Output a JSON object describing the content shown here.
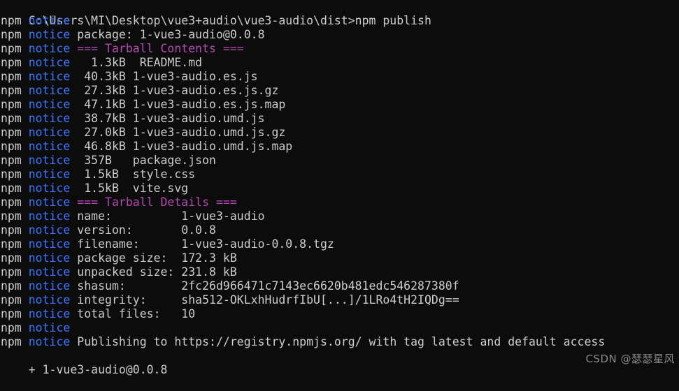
{
  "terminal": {
    "background_color": "#0c0c0c",
    "default_text_color": "#cccccc",
    "notice_color": "#3b78ff",
    "heading_color": "#b44ab4",
    "prompt_line": "C:\\Users\\MI\\Desktop\\vue3+audio\\vue3-audio\\dist>npm publish",
    "prompt_path": "C:\\Users\\MI\\Desktop\\vue3+audio\\vue3-audio\\dist>",
    "command": "npm publish",
    "prefix_npm": "npm ",
    "prefix_notice": "notice",
    "lines": [
      {
        "prefix": "npm ",
        "tag": "notice",
        "rest": "",
        "rest_color": "default"
      },
      {
        "prefix": "npm ",
        "tag": "notice",
        "rest": " package: 1-vue3-audio@0.0.8",
        "rest_color": "default"
      },
      {
        "prefix": "npm ",
        "tag": "notice",
        "rest": " === Tarball Contents ===",
        "rest_color": "magenta"
      },
      {
        "prefix": "npm ",
        "tag": "notice",
        "rest": "   1.3kB  README.md",
        "rest_color": "default"
      },
      {
        "prefix": "npm ",
        "tag": "notice",
        "rest": "  40.3kB 1-vue3-audio.es.js",
        "rest_color": "default"
      },
      {
        "prefix": "npm ",
        "tag": "notice",
        "rest": "  27.3kB 1-vue3-audio.es.js.gz",
        "rest_color": "default"
      },
      {
        "prefix": "npm ",
        "tag": "notice",
        "rest": "  47.1kB 1-vue3-audio.es.js.map",
        "rest_color": "default"
      },
      {
        "prefix": "npm ",
        "tag": "notice",
        "rest": "  38.7kB 1-vue3-audio.umd.js",
        "rest_color": "default"
      },
      {
        "prefix": "npm ",
        "tag": "notice",
        "rest": "  27.0kB 1-vue3-audio.umd.js.gz",
        "rest_color": "default"
      },
      {
        "prefix": "npm ",
        "tag": "notice",
        "rest": "  46.8kB 1-vue3-audio.umd.js.map",
        "rest_color": "default"
      },
      {
        "prefix": "npm ",
        "tag": "notice",
        "rest": "  357B   package.json",
        "rest_color": "default"
      },
      {
        "prefix": "npm ",
        "tag": "notice",
        "rest": "  1.5kB  style.css",
        "rest_color": "default"
      },
      {
        "prefix": "npm ",
        "tag": "notice",
        "rest": "  1.5kB  vite.svg",
        "rest_color": "default"
      },
      {
        "prefix": "npm ",
        "tag": "notice",
        "rest": " === Tarball Details ===",
        "rest_color": "magenta"
      },
      {
        "prefix": "npm ",
        "tag": "notice",
        "rest": " name:          1-vue3-audio",
        "rest_color": "default"
      },
      {
        "prefix": "npm ",
        "tag": "notice",
        "rest": " version:       0.0.8",
        "rest_color": "default"
      },
      {
        "prefix": "npm ",
        "tag": "notice",
        "rest": " filename:      1-vue3-audio-0.0.8.tgz",
        "rest_color": "default"
      },
      {
        "prefix": "npm ",
        "tag": "notice",
        "rest": " package size:  172.3 kB",
        "rest_color": "default"
      },
      {
        "prefix": "npm ",
        "tag": "notice",
        "rest": " unpacked size: 231.8 kB",
        "rest_color": "default"
      },
      {
        "prefix": "npm ",
        "tag": "notice",
        "rest": " shasum:        2fc26d966471c7143ec6620b481edc546287380f",
        "rest_color": "default"
      },
      {
        "prefix": "npm ",
        "tag": "notice",
        "rest": " integrity:     sha512-OKLxhHudrfIbU[...]/1LRo4tH2IQDg==",
        "rest_color": "default"
      },
      {
        "prefix": "npm ",
        "tag": "notice",
        "rest": " total files:   10",
        "rest_color": "default"
      },
      {
        "prefix": "npm ",
        "tag": "notice",
        "rest": "",
        "rest_color": "default"
      },
      {
        "prefix": "npm ",
        "tag": "notice",
        "rest": " Publishing to https://registry.npmjs.org/ with tag latest and default access",
        "rest_color": "default"
      }
    ],
    "result_line": "+ 1-vue3-audio@0.0.8",
    "watermark": "CSDN @瑟瑟星风"
  },
  "package": {
    "name": "1-vue3-audio",
    "version": "0.0.8",
    "filename": "1-vue3-audio-0.0.8.tgz",
    "package_size": "172.3 kB",
    "unpacked_size": "231.8 kB",
    "shasum": "2fc26d966471c7143ec6620b481edc546287380f",
    "integrity": "sha512-OKLxhHudrfIbU[...]/1LRo4tH2IQDg==",
    "total_files": "10",
    "registry": "https://registry.npmjs.org/",
    "tag": "latest",
    "access": "default"
  },
  "tarball_contents": [
    {
      "size": "1.3kB",
      "file": "README.md"
    },
    {
      "size": "40.3kB",
      "file": "1-vue3-audio.es.js"
    },
    {
      "size": "27.3kB",
      "file": "1-vue3-audio.es.js.gz"
    },
    {
      "size": "47.1kB",
      "file": "1-vue3-audio.es.js.map"
    },
    {
      "size": "38.7kB",
      "file": "1-vue3-audio.umd.js"
    },
    {
      "size": "27.0kB",
      "file": "1-vue3-audio.umd.js.gz"
    },
    {
      "size": "46.8kB",
      "file": "1-vue3-audio.umd.js.map"
    },
    {
      "size": "357B",
      "file": "package.json"
    },
    {
      "size": "1.5kB",
      "file": "style.css"
    },
    {
      "size": "1.5kB",
      "file": "vite.svg"
    }
  ]
}
